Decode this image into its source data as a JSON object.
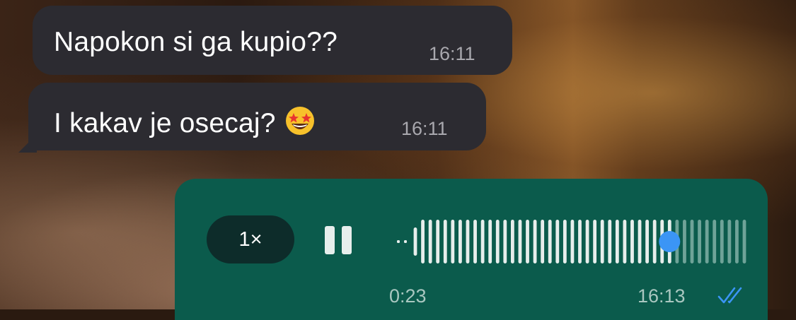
{
  "messages_incoming": [
    {
      "text": "Napokon si ga kupio??",
      "time": "16:11"
    },
    {
      "text": "I kakav je osecaj?",
      "emoji": "star-struck-emoji",
      "time": "16:11"
    }
  ],
  "voice_message": {
    "speed_label": "1×",
    "state": "playing",
    "playback_progress": 0.78,
    "waveform_bar_count": 45,
    "duration": "0:23",
    "time": "16:13",
    "status": "read",
    "colors": {
      "bubble": "#0b5b4c",
      "played": "#e7eeec",
      "unplayed": "#6fa398",
      "thumb": "#3b95f5",
      "ticks": "#3b95f5"
    }
  }
}
